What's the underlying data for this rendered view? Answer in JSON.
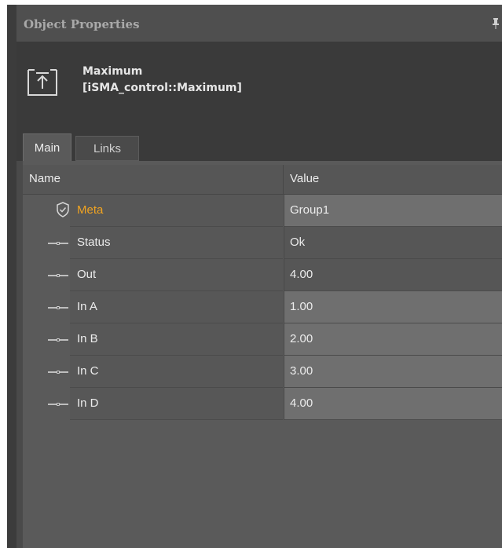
{
  "panel": {
    "title": "Object Properties"
  },
  "object": {
    "name": "Maximum",
    "type": "[iSMA_control::Maximum]"
  },
  "tabs": [
    {
      "label": "Main",
      "active": true
    },
    {
      "label": "Links",
      "active": false
    }
  ],
  "grid": {
    "columns": {
      "name": "Name",
      "value": "Value"
    },
    "rows": [
      {
        "name": "Meta",
        "value": "Group1",
        "icon": "shield-check-icon"
      },
      {
        "name": "Status",
        "value": "Ok",
        "icon": "slot-icon"
      },
      {
        "name": "Out",
        "value": "4.00",
        "icon": "slot-icon"
      },
      {
        "name": "In A",
        "value": "1.00",
        "icon": "slot-icon"
      },
      {
        "name": "In B",
        "value": "2.00",
        "icon": "slot-icon"
      },
      {
        "name": "In C",
        "value": "3.00",
        "icon": "slot-icon"
      },
      {
        "name": "In D",
        "value": "4.00",
        "icon": "slot-icon"
      }
    ]
  },
  "colors": {
    "meta_label": "#f0a321",
    "panel_bg": "#5a5a5a",
    "header_bg": "#3a3a3a"
  }
}
